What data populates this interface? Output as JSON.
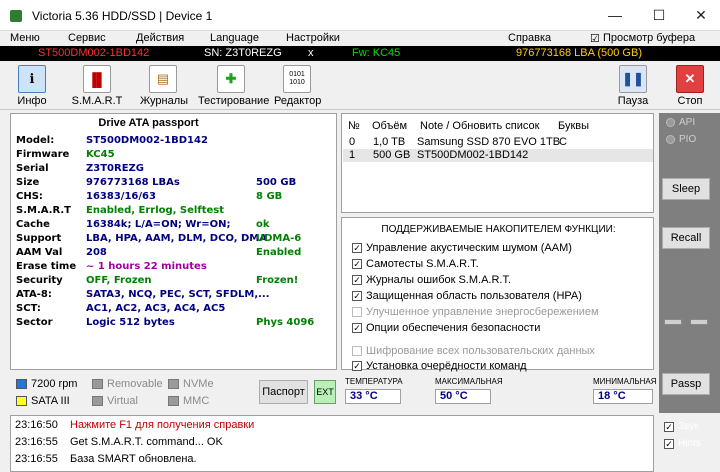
{
  "window": {
    "title": "Victoria 5.36 HDD/SSD | Device 1",
    "minimize": "—",
    "maximize": "☐",
    "close": "✕"
  },
  "menu": {
    "items": [
      "Меню",
      "Сервис",
      "Действия",
      "Language",
      "Настройки",
      "Справка"
    ],
    "buffer_view": "Просмотр буфера"
  },
  "device_strip": {
    "model": "ST500DM002-1BD142",
    "serial": "SN: Z3T0REZG",
    "close_mark": "x",
    "firmware": "Fw: KC45",
    "capacity": "976773168 LBA (500 GB)"
  },
  "toolbar": {
    "info": "Инфо",
    "smart": "S.M.A.R.T",
    "journals": "Журналы",
    "testing": "Тестирование",
    "editor": "Редактор",
    "pause": "Пауза",
    "stop": "Стоп"
  },
  "passport": {
    "header": "Drive ATA passport",
    "rows": [
      {
        "key": "Model:",
        "value": "ST500DM002-1BD142",
        "value2": ""
      },
      {
        "key": "Firmware",
        "value": "KC45",
        "value2": ""
      },
      {
        "key": "Serial",
        "value": "Z3T0REZG",
        "value2": ""
      },
      {
        "key": "Size",
        "value": "976773168 LBAs",
        "value2": "500 GB"
      },
      {
        "key": "CHS:",
        "value": "16383/16/63",
        "value2": "8 GB"
      },
      {
        "key": "S.M.A.R.T",
        "value": "Enabled, Errlog, Selftest",
        "value2": ""
      },
      {
        "key": "Cache",
        "value": "16384k; L/A=ON; Wr=ON;",
        "value2": "ok"
      },
      {
        "key": "Support",
        "value": "LBA, HPA, AAM, DLM, DCO, DMA",
        "value2": "UDMA-6"
      },
      {
        "key": "AAM Val",
        "value": "208",
        "value2": "Enabled"
      },
      {
        "key": "Erase time",
        "value": "~ 1 hours 22 minutes",
        "value2": ""
      },
      {
        "key": "Security",
        "value": "OFF, Frozen",
        "value2": "Frozen!"
      },
      {
        "key": "ATA-8:",
        "value": "SATA3, NCQ, PEC, SCT, SFDLM,...",
        "value2": ""
      },
      {
        "key": "SCT:",
        "value": "AC1, AC2, AC3, AC4, AC5",
        "value2": ""
      },
      {
        "key": "Sector",
        "value": "Logic 512 bytes",
        "value2": "Phys 4096"
      }
    ]
  },
  "drives": {
    "headers": [
      "№",
      "Объём",
      "Note / Обновить список",
      "Буквы"
    ],
    "rows": [
      {
        "num": "0",
        "size": "1,0 TB",
        "note": "Samsung SSD 870 EVO 1TB",
        "letters": "C"
      },
      {
        "num": "1",
        "size": "500 GB",
        "note": "ST500DM002-1BD142",
        "letters": ""
      }
    ]
  },
  "functions": {
    "title": "ПОДДЕРЖИВАЕМЫЕ НАКОПИТЕЛЕМ ФУНКЦИИ:",
    "items": [
      {
        "label": "Управление акустическим шумом (AAM)",
        "checked": "✓"
      },
      {
        "label": "Самотесты S.M.A.R.T.",
        "checked": "✓"
      },
      {
        "label": "Журналы ошибок S.M.A.R.T.",
        "checked": "✓"
      },
      {
        "label": "Защищенная область пользователя (HPA)",
        "checked": "✓"
      },
      {
        "label": "Улучшенное управление энергосбережением",
        "checked": ""
      },
      {
        "label": "Опции обеспечения безопасности",
        "checked": "✓"
      },
      {
        "label": "Шифрование всех пользовательских данных",
        "checked": ""
      },
      {
        "label": "Установка очерёдности команд",
        "checked": "✓"
      }
    ]
  },
  "right": {
    "api": "API",
    "pio": "PIO",
    "sleep": "Sleep",
    "recall": "Recall",
    "passp": "Passp"
  },
  "legend": {
    "rpm": "7200 rpm",
    "removable": "Removable",
    "nvme": "NVMe",
    "sata": "SATA III",
    "virtual": "Virtual",
    "mmc": "MMC"
  },
  "buttons": {
    "passport": "Паспорт",
    "ext": "EXT"
  },
  "temps": {
    "current_label": "ТЕМПЕРАТУРА",
    "current": "33 °C",
    "max_label": "МАКСИМАЛЬНАЯ",
    "max": "50 °C",
    "min_label": "МИНИМАЛЬНАЯ",
    "min": "18 °C"
  },
  "log": [
    {
      "time": "23:16:50",
      "text": "Нажмите F1 для получения справки"
    },
    {
      "time": "23:16:55",
      "text": "Get S.M.A.R.T. command... OK"
    },
    {
      "time": "23:16:55",
      "text": "База SMART обновлена."
    }
  ],
  "options": {
    "sound": "Звук",
    "hints": "Hints"
  },
  "colors": {
    "strip_model": "#ff3030",
    "strip_fw": "#00e000",
    "strip_capacity": "#ffd000",
    "value_blue": "#000080",
    "value_green": "#008000",
    "value_magenta": "#a000a0",
    "log_red": "#c00000"
  }
}
